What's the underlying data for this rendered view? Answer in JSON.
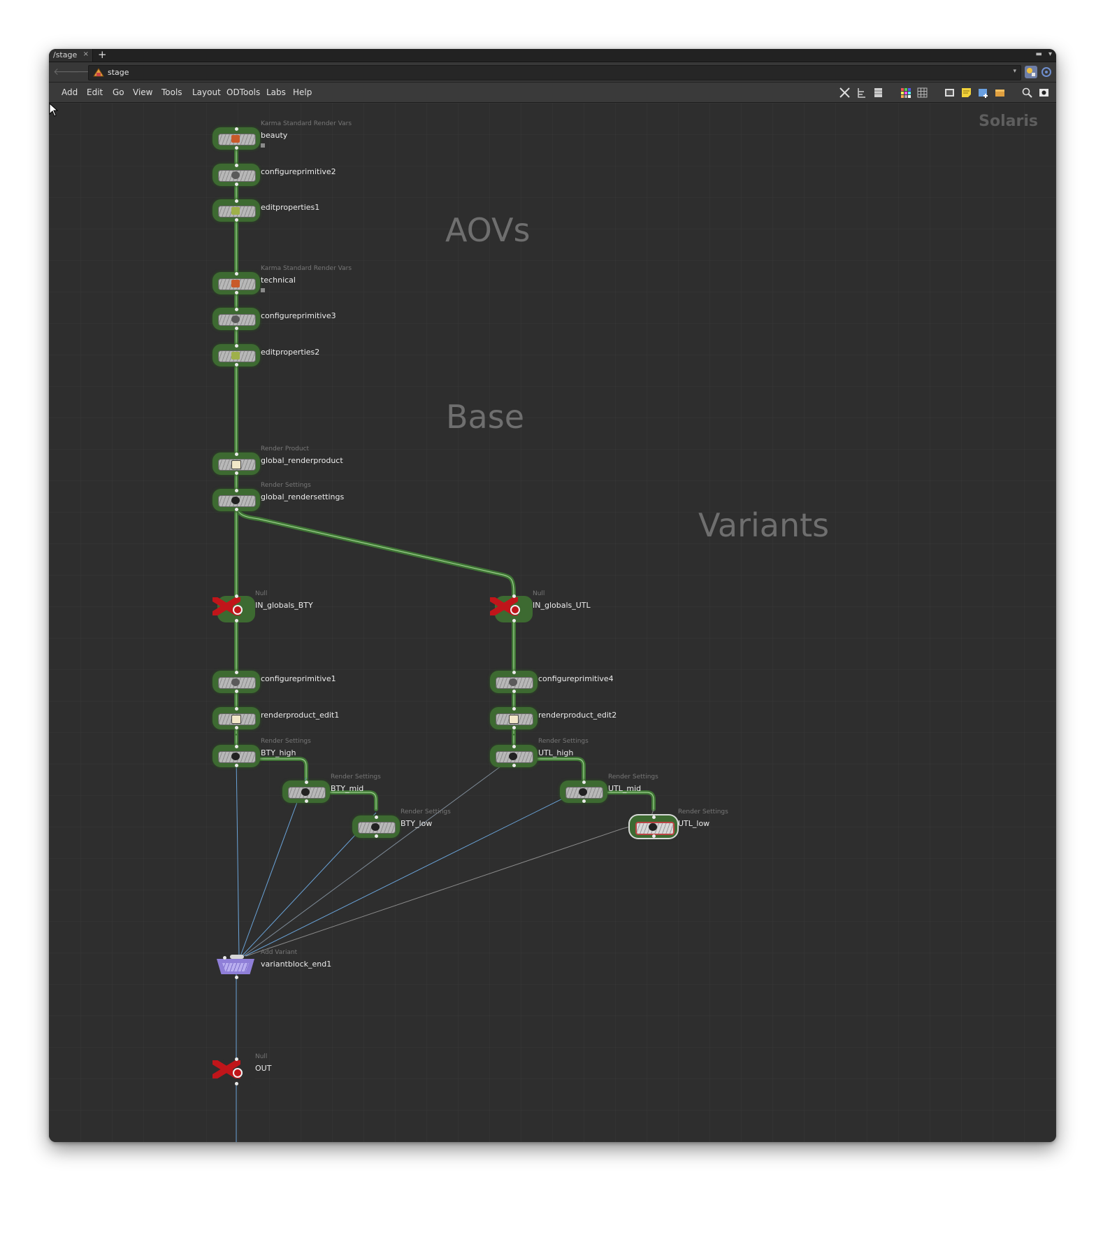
{
  "tabs": [
    {
      "label": "/stage",
      "close": "×"
    }
  ],
  "tab_add": "+",
  "window_controls": {
    "maximize": "▬",
    "menu": "▾"
  },
  "nav": {
    "back": "🡐",
    "forward": "🡒"
  },
  "path": {
    "value": "stage",
    "dropdown": "▾"
  },
  "menu": [
    "Add",
    "Edit",
    "Go",
    "View",
    "Tools",
    "Layout",
    "ODTools",
    "Labs",
    "Help"
  ],
  "toolbar_icons": [
    "wrench-icon",
    "tree-layout-icon",
    "list-icon",
    "color-palette-icon",
    "grid-icon",
    "image-icon",
    "sticky-note-icon",
    "add-image-icon",
    "network-box-icon",
    "search-icon",
    "eye-icon"
  ],
  "context_label": "Solaris",
  "network_boxes": {
    "aovs": "AOVs",
    "base": "Base",
    "variants": "Variants"
  },
  "nodes": {
    "beauty": {
      "type": "Karma Standard Render Vars",
      "name": "beauty"
    },
    "configureprimitive2": {
      "type": "",
      "name": "configureprimitive2"
    },
    "editproperties1": {
      "type": "",
      "name": "editproperties1"
    },
    "technical": {
      "type": "Karma Standard Render Vars",
      "name": "technical"
    },
    "configureprimitive3": {
      "type": "",
      "name": "configureprimitive3"
    },
    "editproperties2": {
      "type": "",
      "name": "editproperties2"
    },
    "global_renderproduct": {
      "type": "Render Product",
      "name": "global_renderproduct"
    },
    "global_rendersettings": {
      "type": "Render Settings",
      "name": "global_rendersettings"
    },
    "in_globals_bty": {
      "type": "Null",
      "name": "IN_globals_BTY"
    },
    "in_globals_utl": {
      "type": "Null",
      "name": "IN_globals_UTL"
    },
    "configureprimitive1": {
      "type": "",
      "name": "configureprimitive1"
    },
    "configureprimitive4": {
      "type": "",
      "name": "configureprimitive4"
    },
    "renderproduct_edit1": {
      "type": "",
      "name": "renderproduct_edit1"
    },
    "renderproduct_edit2": {
      "type": "",
      "name": "renderproduct_edit2"
    },
    "bty_high": {
      "type": "Render Settings",
      "name": "BTY_high"
    },
    "bty_mid": {
      "type": "Render Settings",
      "name": "BTY_mid"
    },
    "bty_low": {
      "type": "Render Settings",
      "name": "BTY_low"
    },
    "utl_high": {
      "type": "Render Settings",
      "name": "UTL_high"
    },
    "utl_mid": {
      "type": "Render Settings",
      "name": "UTL_mid"
    },
    "utl_low": {
      "type": "Render Settings",
      "name": "UTL_low"
    },
    "variantblock_end1": {
      "type": "Add Variant",
      "name": "variantblock_end1"
    },
    "out": {
      "type": "Null",
      "name": "OUT"
    }
  },
  "colors": {
    "wire_active": "#4f8e45",
    "wire_variant": "#6aa3d8",
    "node_green": "#3d6a31",
    "null_red": "#c0151a",
    "variant_purple": "#8f7fd8"
  }
}
